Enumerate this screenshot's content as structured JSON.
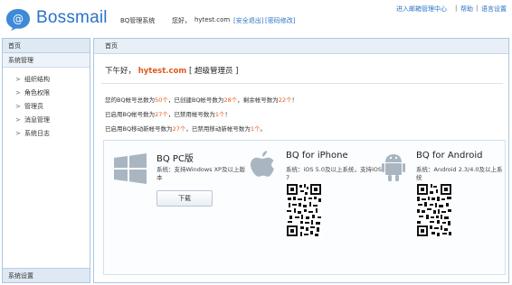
{
  "header": {
    "logo_text": "Bossmail",
    "system_name": "BQ管理系统",
    "greeting": "您好，",
    "domain": "hytest.com",
    "safe_logout": "[安全退出]",
    "change_password": "[密码修改]",
    "top_links": [
      "进入邮箱管理中心",
      "帮助",
      "语言设置"
    ],
    "top_sep": "|"
  },
  "sidebar": {
    "home": "首页",
    "group": "系统管理",
    "items": [
      {
        "label": "组织结构"
      },
      {
        "label": "角色权限"
      },
      {
        "label": "管理员"
      },
      {
        "label": "消息管理"
      },
      {
        "label": "系统日志"
      }
    ],
    "bottom": "系统设置",
    "chevron": ">"
  },
  "main": {
    "tab_title": "首页",
    "welcome_prefix": "下午好，",
    "welcome_domain": "hytest.com",
    "welcome_role": "[ 超级管理员 ]",
    "stats": {
      "line1": {
        "a": "您的BQ帐号总数为",
        "n1": "50个",
        "b": "，已创建BQ帐号数为",
        "n2": "28个",
        "c": "，剩余帐号数为",
        "n3": "22个",
        "d": "！"
      },
      "line2": {
        "a": "已启用BQ帐号数为",
        "n1": "27个",
        "b": "，已禁用帐号数为",
        "n2": "1个",
        "c": "！"
      },
      "line3": {
        "a": "已启用BQ移动新帐号数为",
        "n1": "27个",
        "b": "，已禁用移动新帐号数为",
        "n2": "1个",
        "c": "。"
      }
    }
  },
  "downloads": {
    "pc": {
      "title": "BQ PC版",
      "desc": "系统：支持Windows XP及以上版本",
      "button": "下载"
    },
    "iphone": {
      "title": "BQ for iPhone",
      "desc": "系统：iOS 5.0及以上系统，支持iOS 7"
    },
    "android": {
      "title": "BQ for Android",
      "desc": "系统：Android 2.3/4.0及以上系统"
    }
  },
  "colors": {
    "brand": "#2a73c6",
    "accent": "#e0591b",
    "icon_gray": "#a9b6c2"
  }
}
